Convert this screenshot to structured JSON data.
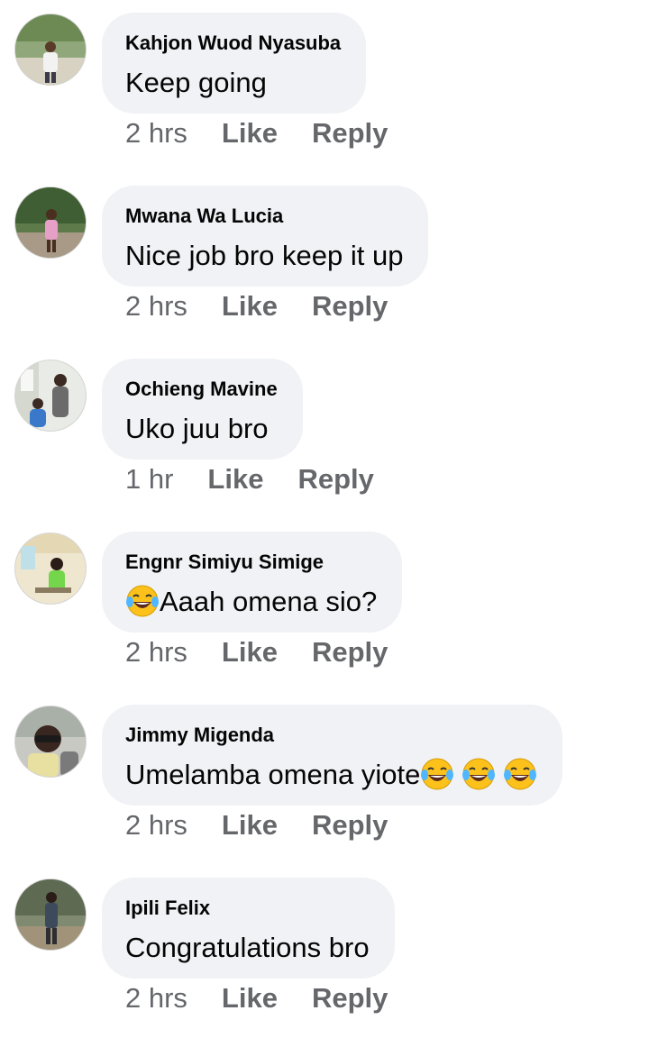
{
  "comments": [
    {
      "author": "Kahjon Wuod Nyasuba",
      "text": "Keep going",
      "emoji_after": 0,
      "time": "2 hrs",
      "like_label": "Like",
      "reply_label": "Reply",
      "avatar_icon": "profile-photo-avatar"
    },
    {
      "author": "Mwana Wa Lucia",
      "text": "Nice job bro keep it up",
      "emoji_after": 0,
      "time": "2 hrs",
      "like_label": "Like",
      "reply_label": "Reply",
      "avatar_icon": "profile-photo-avatar"
    },
    {
      "author": "Ochieng Mavine",
      "text": "Uko juu bro",
      "emoji_after": 0,
      "time": "1 hr",
      "like_label": "Like",
      "reply_label": "Reply",
      "avatar_icon": "profile-photo-avatar"
    },
    {
      "author": "Engnr Simiyu Simige",
      "text": "Aaah omena sio?",
      "emoji_before": 1,
      "emoji_after": 0,
      "time": "2 hrs",
      "like_label": "Like",
      "reply_label": "Reply",
      "avatar_icon": "profile-photo-avatar",
      "emoji_icon": "face-with-tears-of-joy-icon"
    },
    {
      "author": "Jimmy Migenda",
      "text": "Umelamba omena yiote",
      "emoji_after": 3,
      "time": "2 hrs",
      "like_label": "Like",
      "reply_label": "Reply",
      "avatar_icon": "profile-photo-avatar",
      "emoji_icon": "face-with-tears-of-joy-icon"
    },
    {
      "author": "Ipili Felix",
      "text": "Congratulations bro",
      "emoji_after": 0,
      "time": "2 hrs",
      "like_label": "Like",
      "reply_label": "Reply",
      "avatar_icon": "profile-photo-avatar"
    }
  ],
  "colors": {
    "bubble_background": "#f0f2f5",
    "author_text": "#050505",
    "comment_text": "#050505",
    "meta_text": "#65676b",
    "emoji_face": "#fcc21b"
  }
}
